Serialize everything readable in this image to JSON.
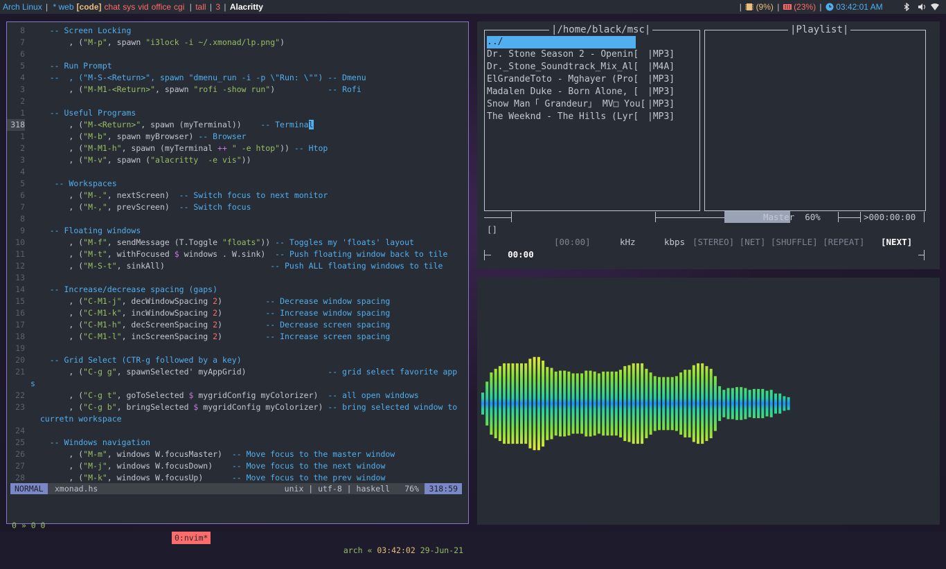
{
  "topbar": {
    "distro": "Arch Linux",
    "workspaces": [
      {
        "label": "* web",
        "color": "#51afef"
      },
      {
        "label": "[code]",
        "color": "#ecbe7b"
      },
      {
        "label": "chat",
        "color": "#ff6c6b"
      },
      {
        "label": "sys",
        "color": "#ff6c6b"
      },
      {
        "label": "vid",
        "color": "#ff6c6b"
      },
      {
        "label": "office",
        "color": "#ff6c6b"
      },
      {
        "label": "cgi",
        "color": "#ff6c6b"
      }
    ],
    "layout": "tall",
    "window_count": "3",
    "window_title": "Alacritty",
    "cpu": "(9%)",
    "mem": "(23%)",
    "clock": "03:42:01 AM"
  },
  "editor": {
    "lines": [
      {
        "num": "8",
        "segs": [
          [
            "t",
            "    "
          ],
          [
            "c",
            "-- Screen Locking"
          ]
        ]
      },
      {
        "num": "7",
        "segs": [
          [
            "t",
            "        , ("
          ],
          [
            "s",
            "\"M-p\""
          ],
          [
            "t",
            ", spawn "
          ],
          [
            "s",
            "\"i3lock -i ~/.xmonad/lp.png\""
          ],
          [
            "t",
            ")"
          ]
        ]
      },
      {
        "num": "6",
        "segs": []
      },
      {
        "num": "5",
        "segs": [
          [
            "t",
            "    "
          ],
          [
            "c",
            "-- Run Prompt"
          ]
        ]
      },
      {
        "num": "4",
        "segs": [
          [
            "t",
            "    "
          ],
          [
            "c",
            "--  , (\"M-S-<Return>\", spawn \"dmenu_run -i -p \\\"Run: \\\"\") -- Dmenu"
          ]
        ]
      },
      {
        "num": "3",
        "segs": [
          [
            "t",
            "        , ("
          ],
          [
            "s",
            "\"M-M1-<Return>\""
          ],
          [
            "t",
            ", spawn "
          ],
          [
            "s",
            "\"rofi -show run\""
          ],
          [
            "t",
            ")           "
          ],
          [
            "c",
            "-- Rofi"
          ]
        ]
      },
      {
        "num": "2",
        "segs": []
      },
      {
        "num": "1",
        "segs": [
          [
            "t",
            "    "
          ],
          [
            "c",
            "-- Useful Programs"
          ]
        ]
      },
      {
        "num": "318",
        "cur": true,
        "segs": [
          [
            "t",
            "        , ("
          ],
          [
            "s",
            "\"M-<Return>\""
          ],
          [
            "t",
            ", spawn (myTerminal))    "
          ],
          [
            "c",
            "-- Termina"
          ],
          [
            "k",
            "l"
          ]
        ]
      },
      {
        "num": "1",
        "segs": [
          [
            "t",
            "        , ("
          ],
          [
            "s",
            "\"M-b\""
          ],
          [
            "t",
            ", spawn myBrowser) "
          ],
          [
            "c",
            "-- Browser"
          ]
        ]
      },
      {
        "num": "2",
        "segs": [
          [
            "t",
            "        , ("
          ],
          [
            "s",
            "\"M-M1-h\""
          ],
          [
            "t",
            ", spawn (myTerminal "
          ],
          [
            "o",
            "++"
          ],
          [
            "s",
            " \" -e htop\""
          ],
          [
            "t",
            ")) "
          ],
          [
            "c",
            "-- Htop"
          ]
        ]
      },
      {
        "num": "3",
        "segs": [
          [
            "t",
            "        , ("
          ],
          [
            "s",
            "\"M-v\""
          ],
          [
            "t",
            ", spawn ("
          ],
          [
            "s",
            "\"alacritty  -e vis\""
          ],
          [
            "t",
            "))"
          ]
        ]
      },
      {
        "num": "4",
        "segs": []
      },
      {
        "num": "5",
        "segs": [
          [
            "t",
            "     "
          ],
          [
            "c",
            "-- Workspaces"
          ]
        ]
      },
      {
        "num": "6",
        "segs": [
          [
            "t",
            "        , ("
          ],
          [
            "s",
            "\"M-.\""
          ],
          [
            "t",
            ", nextScreen)  "
          ],
          [
            "c",
            "-- Switch focus to next monitor"
          ]
        ]
      },
      {
        "num": "7",
        "segs": [
          [
            "t",
            "        , ("
          ],
          [
            "s",
            "\"M-,\""
          ],
          [
            "t",
            ", prevScreen)  "
          ],
          [
            "c",
            "-- Switch focus"
          ]
        ]
      },
      {
        "num": "8",
        "segs": []
      },
      {
        "num": "9",
        "segs": [
          [
            "t",
            "    "
          ],
          [
            "c",
            "-- Floating windows"
          ]
        ]
      },
      {
        "num": "10",
        "segs": [
          [
            "t",
            "        , ("
          ],
          [
            "s",
            "\"M-f\""
          ],
          [
            "t",
            ", sendMessage (T.Toggle "
          ],
          [
            "s",
            "\"floats\""
          ],
          [
            "t",
            ")) "
          ],
          [
            "c",
            "-- Toggles my 'floats' layout"
          ]
        ]
      },
      {
        "num": "11",
        "segs": [
          [
            "t",
            "        , ("
          ],
          [
            "s",
            "\"M-t\""
          ],
          [
            "t",
            ", withFocused "
          ],
          [
            "o",
            "$"
          ],
          [
            "t",
            " windows . W.sink)  "
          ],
          [
            "c",
            "-- Push floating window back to tile"
          ]
        ]
      },
      {
        "num": "12",
        "segs": [
          [
            "t",
            "        , ("
          ],
          [
            "s",
            "\"M-S-t\""
          ],
          [
            "t",
            ", sinkAll)                      "
          ],
          [
            "c",
            "-- Push ALL floating windows to tile"
          ]
        ]
      },
      {
        "num": "13",
        "segs": []
      },
      {
        "num": "14",
        "segs": [
          [
            "t",
            "    "
          ],
          [
            "c",
            "-- Increase/decrease spacing (gaps)"
          ]
        ]
      },
      {
        "num": "15",
        "segs": [
          [
            "t",
            "        , ("
          ],
          [
            "s",
            "\"C-M1-j\""
          ],
          [
            "t",
            ", decWindowSpacing "
          ],
          [
            "n",
            "2"
          ],
          [
            "t",
            ")         "
          ],
          [
            "c",
            "-- Decrease window spacing"
          ]
        ]
      },
      {
        "num": "16",
        "segs": [
          [
            "t",
            "        , ("
          ],
          [
            "s",
            "\"C-M1-k\""
          ],
          [
            "t",
            ", incWindowSpacing "
          ],
          [
            "n",
            "2"
          ],
          [
            "t",
            ")         "
          ],
          [
            "c",
            "-- Increase window spacing"
          ]
        ]
      },
      {
        "num": "17",
        "segs": [
          [
            "t",
            "        , ("
          ],
          [
            "s",
            "\"C-M1-h\""
          ],
          [
            "t",
            ", decScreenSpacing "
          ],
          [
            "n",
            "2"
          ],
          [
            "t",
            ")         "
          ],
          [
            "c",
            "-- Decrease screen spacing"
          ]
        ]
      },
      {
        "num": "18",
        "segs": [
          [
            "t",
            "        , ("
          ],
          [
            "s",
            "\"C-M1-l\""
          ],
          [
            "t",
            ", incScreenSpacing "
          ],
          [
            "n",
            "2"
          ],
          [
            "t",
            ")         "
          ],
          [
            "c",
            "-- Increase screen spacing"
          ]
        ]
      },
      {
        "num": "19",
        "segs": []
      },
      {
        "num": "20",
        "segs": [
          [
            "t",
            "    "
          ],
          [
            "c",
            "-- Grid Select (CTR-g followed by a key)"
          ]
        ]
      },
      {
        "num": "21",
        "segs": [
          [
            "t",
            "        , ("
          ],
          [
            "s",
            "\"C-g g\""
          ],
          [
            "t",
            ", spawnSelected' myAppGrid)                 "
          ],
          [
            "c",
            "-- grid select favorite app"
          ]
        ]
      },
      {
        "num": "",
        "segs": [
          [
            "c",
            "s"
          ]
        ]
      },
      {
        "num": "22",
        "segs": [
          [
            "t",
            "        , ("
          ],
          [
            "s",
            "\"C-g t\""
          ],
          [
            "t",
            ", goToSelected "
          ],
          [
            "o",
            "$"
          ],
          [
            "t",
            " mygridConfig myColorizer)  "
          ],
          [
            "c",
            "-- all open windows"
          ]
        ]
      },
      {
        "num": "23",
        "segs": [
          [
            "t",
            "        , ("
          ],
          [
            "s",
            "\"C-g b\""
          ],
          [
            "t",
            ", bringSelected "
          ],
          [
            "o",
            "$"
          ],
          [
            "t",
            " mygridConfig myColorizer) "
          ],
          [
            "c",
            "-- bring selected window to"
          ]
        ]
      },
      {
        "num": "",
        "segs": [
          [
            "c",
            "  curretn workspace"
          ]
        ]
      },
      {
        "num": "24",
        "segs": []
      },
      {
        "num": "25",
        "segs": [
          [
            "t",
            "    "
          ],
          [
            "c",
            "-- Windows navigation"
          ]
        ]
      },
      {
        "num": "26",
        "segs": [
          [
            "t",
            "        , ("
          ],
          [
            "s",
            "\"M-m\""
          ],
          [
            "t",
            ", windows W.focusMaster)  "
          ],
          [
            "c",
            "-- Move focus to the master window"
          ]
        ]
      },
      {
        "num": "27",
        "segs": [
          [
            "t",
            "        , ("
          ],
          [
            "s",
            "\"M-j\""
          ],
          [
            "t",
            ", windows W.focusDown)    "
          ],
          [
            "c",
            "-- Move focus to the next window"
          ]
        ]
      },
      {
        "num": "28",
        "segs": [
          [
            "t",
            "        , ("
          ],
          [
            "s",
            "\"M-k\""
          ],
          [
            "t",
            ", windows W.focusUp)      "
          ],
          [
            "c",
            "-- Move focus to the prev window"
          ]
        ]
      }
    ],
    "status": {
      "mode": "NORMAL",
      "file": "xmonad.hs",
      "encoding": "unix | utf-8 | haskell",
      "percent": "76%",
      "position": "318:59"
    },
    "tmux": {
      "left": "0 » 0 0",
      "window": "0:nvim*",
      "host": "arch «",
      "time": "03:42:02",
      "date": "29-Jun-21"
    }
  },
  "player": {
    "browser_title": "/home/black/msc",
    "playlist_title": "Playlist",
    "parent_dir": "../",
    "files": [
      {
        "name": "Dr. Stone Season 2 - Openin[",
        "ext": "|MP3]"
      },
      {
        "name": "Dr._Stone_Soundtrack_Mix_Al[",
        "ext": "|M4A]"
      },
      {
        "name": "ElGrandeToto - Mghayer (Pro[",
        "ext": "|MP3]"
      },
      {
        "name": "Madalen Duke - Born Alone, [",
        "ext": "|MP3]"
      },
      {
        "name": "Snow Man「 Grandeur」 MV□ You[",
        "ext": "|MP3]"
      },
      {
        "name": "The Weeknd - The Hills (Lyr[",
        "ext": "|MP3]"
      }
    ],
    "volume_label": "Master",
    "volume_percent": "60%",
    "volume_fraction": 0.6,
    "time_display": ">000:00:00",
    "status_glyph": "[]",
    "position": "00:00",
    "duration": "[00:00]",
    "khz": "kHz",
    "kbps": "kbps",
    "flags": [
      "[STEREO]",
      "[NET]",
      "[SHUFFLE]",
      "[REPEAT]"
    ],
    "next_flag": "[NEXT]"
  },
  "visualizer": {
    "amplitudes": [
      0.12,
      0.24,
      0.34,
      0.38,
      0.41,
      0.44,
      0.44,
      0.44,
      0.44,
      0.44,
      0.44,
      0.49,
      0.51,
      0.51,
      0.47,
      0.4,
      0.39,
      0.35,
      0.36,
      0.36,
      0.35,
      0.33,
      0.33,
      0.33,
      0.36,
      0.36,
      0.35,
      0.33,
      0.35,
      0.35,
      0.35,
      0.35,
      0.37,
      0.41,
      0.42,
      0.44,
      0.44,
      0.44,
      0.38,
      0.34,
      0.3,
      0.29,
      0.29,
      0.29,
      0.29,
      0.3,
      0.34,
      0.37,
      0.37,
      0.42,
      0.44,
      0.44,
      0.41,
      0.38,
      0.3,
      0.19,
      0.15,
      0.17,
      0.17,
      0.18,
      0.18,
      0.17,
      0.15,
      0.16,
      0.16,
      0.16,
      0.14,
      0.15,
      0.11,
      0.11,
      0.08,
      0.07
    ],
    "colors": {
      "low": "#1e90ff",
      "mid": "#22d3a2",
      "high": "#ffeb3b",
      "peak": "#ff2d6f"
    }
  }
}
